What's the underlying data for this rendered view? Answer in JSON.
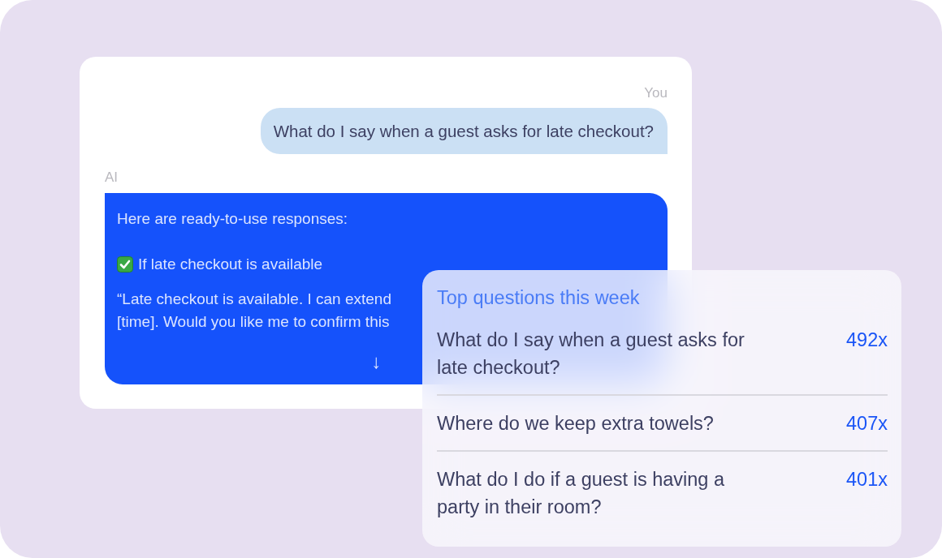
{
  "chat": {
    "messages": [
      {
        "kind": "user",
        "sender": "You",
        "text": "What do I say when a guest asks for late checkout?"
      },
      {
        "kind": "ai",
        "sender": "AI",
        "intro": "Here are ready-to-use responses:",
        "option": "If late checkout is available",
        "quote_lines": [
          "“Late checkout is available. I can extend",
          "[time]. Would you like me to confirm this"
        ],
        "scroll_button": "↓"
      }
    ]
  },
  "top_questions": {
    "title": "Top questions this week",
    "items": [
      {
        "question": "What do I say when a guest asks for late checkout?",
        "count": "492x"
      },
      {
        "question": "Where do we keep extra towels?",
        "count": "407x"
      },
      {
        "question": "What do I do if a guest is having a party in their room?",
        "count": "401x"
      }
    ]
  }
}
